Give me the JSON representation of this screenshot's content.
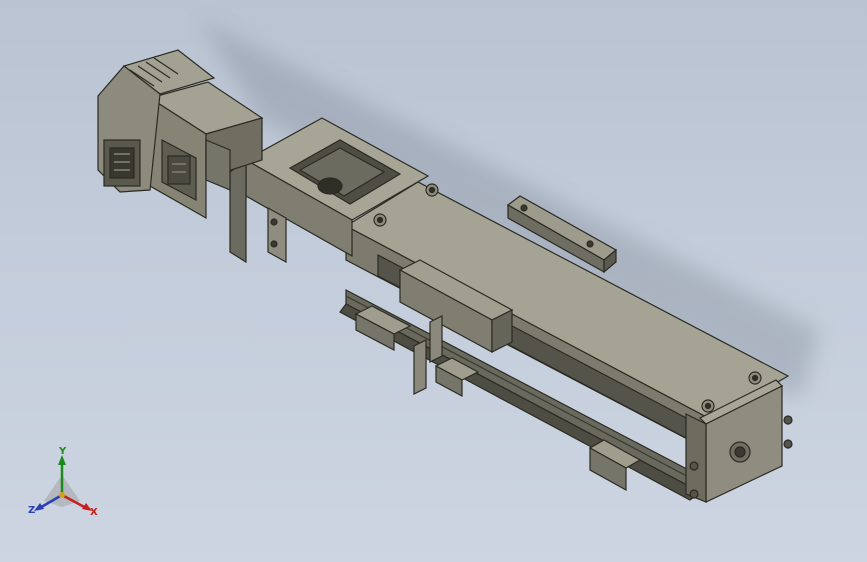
{
  "viewport": {
    "background_top": "#b9c3d2",
    "background_bottom": "#cdd5e2",
    "part_color": "#8a8a7a"
  },
  "triad": {
    "x_label": "X",
    "y_label": "Y",
    "z_label": "Z",
    "x_color": "#c81e1e",
    "y_color": "#1c8a1c",
    "z_color": "#2a3fb0"
  }
}
